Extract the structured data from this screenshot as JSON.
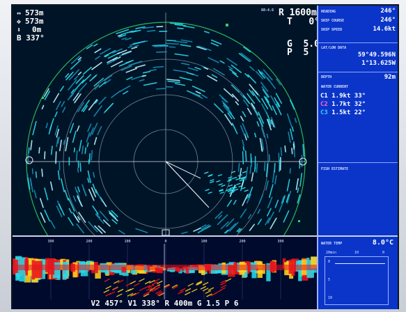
{
  "radar_overlay": {
    "range_label": "R",
    "range_value": "1600m",
    "tilt_label": "T",
    "tilt_value": "0°",
    "gain_label": "G",
    "gain_value": "5.0",
    "p_label": "P",
    "p_value": "5",
    "top_small": "88-4.6",
    "target_h": "573m",
    "target_d": "573m",
    "target_depth": "0m",
    "bearing_label": "B",
    "bearing_value": "337°"
  },
  "sidebar": {
    "heading_label": "HEADING",
    "heading_value": "246°",
    "course_label": "SHIP COURSE",
    "course_value": "246°",
    "speed_label": "SHIP SPEED",
    "speed_value": "14.6kt",
    "latlon_label": "LAT/LON DATA",
    "lat_value": "59°49.596N",
    "lon_value": "1°13.625W",
    "depth_label": "DEPTH",
    "depth_value": "92m",
    "current_label": "WATER CURRENT",
    "currents": [
      {
        "name": "C1",
        "speed": "1.9kt",
        "dir": "33°"
      },
      {
        "name": "C2",
        "speed": "1.7kt",
        "dir": "32°"
      },
      {
        "name": "C3",
        "speed": "1.5kt",
        "dir": "22°"
      }
    ],
    "fish_label": "FISH ESTIMATE"
  },
  "temp_panel": {
    "label": "WATER TEMP",
    "value": "8.0°C",
    "graph_x_left": "20min",
    "graph_x_mid": "10",
    "graph_x_right": "0",
    "graph_y": [
      "0",
      "5",
      "10"
    ]
  },
  "strip": {
    "scale_labels": [
      "300",
      "200",
      "100",
      "0",
      "100",
      "200",
      "300"
    ],
    "status_text": "V2 457° V1 338° R 400m G 1.5 P 6"
  },
  "colors": {
    "echo_cyan": "#29d8e6",
    "echo_red": "#e6141e",
    "panel_blue": "#0a35c8",
    "c1": "#ffffff",
    "c2": "#ff66cc",
    "c3": "#33ccff"
  },
  "icons": {
    "horizontal": "horizontal-distance-icon",
    "direct": "direct-distance-icon",
    "depth": "depth-arrow-icon"
  }
}
